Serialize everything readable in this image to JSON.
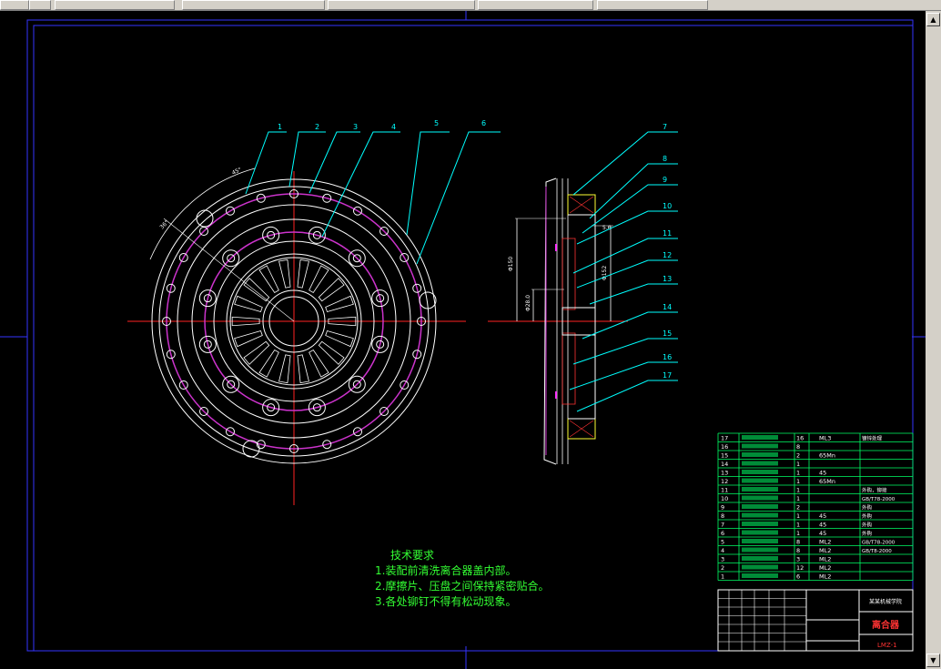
{
  "tech_requirements": {
    "title": "技术要求",
    "items": [
      "1.装配前清洗离合器盖内部。",
      "2.摩擦片、压盘之间保持紧密贴合。",
      "3.各处铆钉不得有松动现象。"
    ]
  },
  "callouts_top": [
    "1",
    "2",
    "3",
    "4",
    "5",
    "6"
  ],
  "callouts_right": [
    "7",
    "8",
    "9",
    "10",
    "11",
    "12",
    "13",
    "14",
    "15",
    "16",
    "17"
  ],
  "dimensions": [
    "Φ150",
    "Φ28.0",
    "Φ152",
    "5.6"
  ],
  "bom_rows": [
    {
      "no": "17",
      "qty": "16",
      "mat": "ML3",
      "note": "镀锌处理"
    },
    {
      "no": "16",
      "qty": "8",
      "mat": "",
      "note": ""
    },
    {
      "no": "15",
      "qty": "2",
      "mat": "65Mn",
      "note": ""
    },
    {
      "no": "14",
      "qty": "1",
      "mat": "",
      "note": ""
    },
    {
      "no": "13",
      "qty": "1",
      "mat": "45",
      "note": ""
    },
    {
      "no": "12",
      "qty": "1",
      "mat": "65Mn",
      "note": ""
    },
    {
      "no": "11",
      "qty": "1",
      "mat": "",
      "note": "外购，铆接"
    },
    {
      "no": "10",
      "qty": "1",
      "mat": "",
      "note": "GB/T78-2000"
    },
    {
      "no": "9",
      "qty": "2",
      "mat": "",
      "note": "外购"
    },
    {
      "no": "8",
      "qty": "1",
      "mat": "45",
      "note": "外购"
    },
    {
      "no": "7",
      "qty": "1",
      "mat": "45",
      "note": "外购"
    },
    {
      "no": "6",
      "qty": "1",
      "mat": "45",
      "note": "外购"
    },
    {
      "no": "5",
      "qty": "8",
      "mat": "ML2",
      "note": "GB/T78-2000"
    },
    {
      "no": "4",
      "qty": "8",
      "mat": "ML2",
      "note": "GB/T8-2000"
    },
    {
      "no": "3",
      "qty": "3",
      "mat": "ML2",
      "note": ""
    },
    {
      "no": "2",
      "qty": "12",
      "mat": "ML2",
      "note": ""
    },
    {
      "no": "1",
      "qty": "6",
      "mat": "ML2",
      "note": ""
    }
  ],
  "title_block": {
    "name": "离合器",
    "code": "LMZ-1",
    "school": "某某机械学院"
  },
  "colors": {
    "background": "#000000",
    "border": "#3333ff",
    "callout": "#00ffff",
    "centerline": "#ff0000",
    "hidden_circle": "#cc33cc",
    "text": "#33ff33",
    "part": "#ffffff"
  }
}
